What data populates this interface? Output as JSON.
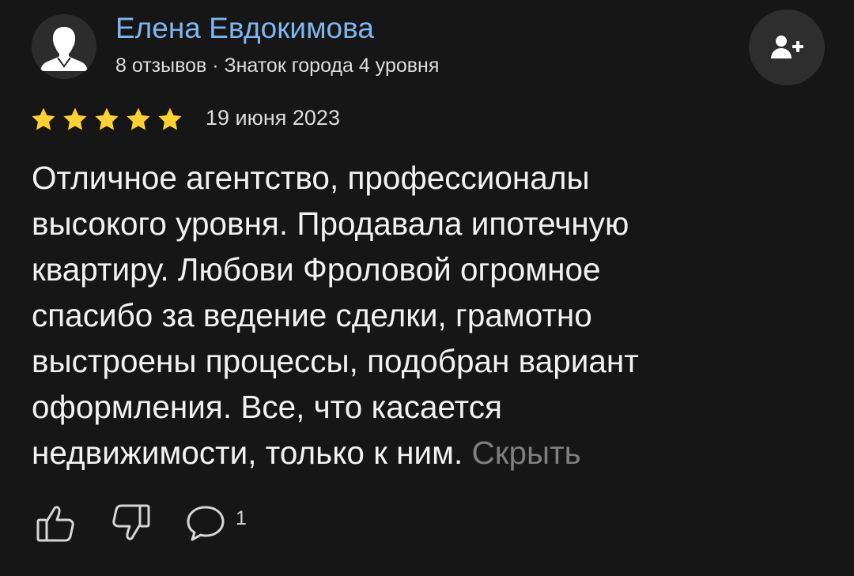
{
  "author": {
    "name": "Елена Евдокимова",
    "meta": "8 отзывов · Знаток города 4 уровня",
    "avatar_icon": "user-silhouette-icon"
  },
  "subscribe": {
    "icon": "add-user-icon"
  },
  "review": {
    "rating": 5,
    "rating_max": 5,
    "star_color": "#fcd131",
    "date": "19 июня 2023",
    "text_lines": [
      "Отличное агентство, профессионалы",
      "высокого уровня. Продавала ипотечную",
      "квартиру. Любови Фроловой огромное",
      "спасибо за ведение сделки, грамотно",
      "выстроены процессы, подобран вариант",
      "оформления. Все, что касается",
      "недвижимости, только к ним."
    ],
    "hide_label": "Скрыть"
  },
  "actions": {
    "like_icon": "thumbs-up-icon",
    "dislike_icon": "thumbs-down-icon",
    "comment_icon": "comment-icon",
    "comment_count": "1"
  },
  "colors": {
    "background": "#161616",
    "author_name": "#7fb6ee",
    "link_muted": "#7e7e7e"
  }
}
